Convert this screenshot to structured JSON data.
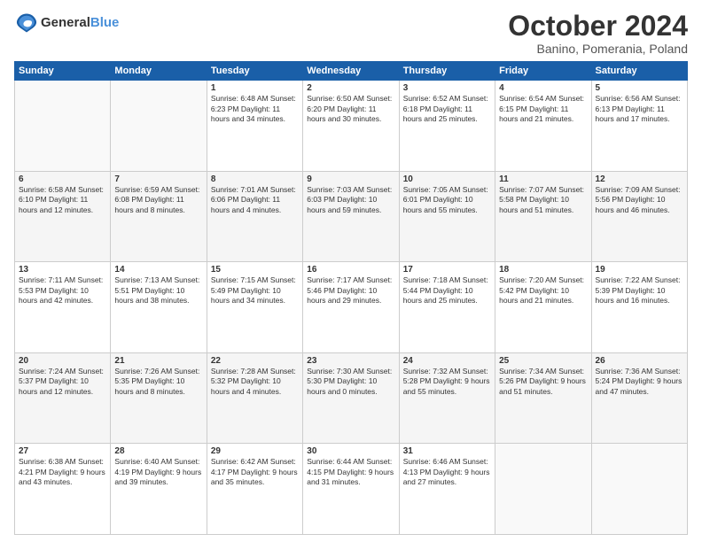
{
  "header": {
    "logo_general": "General",
    "logo_blue": "Blue",
    "month": "October 2024",
    "location": "Banino, Pomerania, Poland"
  },
  "days_of_week": [
    "Sunday",
    "Monday",
    "Tuesday",
    "Wednesday",
    "Thursday",
    "Friday",
    "Saturday"
  ],
  "weeks": [
    [
      {
        "day": "",
        "info": ""
      },
      {
        "day": "",
        "info": ""
      },
      {
        "day": "1",
        "info": "Sunrise: 6:48 AM\nSunset: 6:23 PM\nDaylight: 11 hours\nand 34 minutes."
      },
      {
        "day": "2",
        "info": "Sunrise: 6:50 AM\nSunset: 6:20 PM\nDaylight: 11 hours\nand 30 minutes."
      },
      {
        "day": "3",
        "info": "Sunrise: 6:52 AM\nSunset: 6:18 PM\nDaylight: 11 hours\nand 25 minutes."
      },
      {
        "day": "4",
        "info": "Sunrise: 6:54 AM\nSunset: 6:15 PM\nDaylight: 11 hours\nand 21 minutes."
      },
      {
        "day": "5",
        "info": "Sunrise: 6:56 AM\nSunset: 6:13 PM\nDaylight: 11 hours\nand 17 minutes."
      }
    ],
    [
      {
        "day": "6",
        "info": "Sunrise: 6:58 AM\nSunset: 6:10 PM\nDaylight: 11 hours\nand 12 minutes."
      },
      {
        "day": "7",
        "info": "Sunrise: 6:59 AM\nSunset: 6:08 PM\nDaylight: 11 hours\nand 8 minutes."
      },
      {
        "day": "8",
        "info": "Sunrise: 7:01 AM\nSunset: 6:06 PM\nDaylight: 11 hours\nand 4 minutes."
      },
      {
        "day": "9",
        "info": "Sunrise: 7:03 AM\nSunset: 6:03 PM\nDaylight: 10 hours\nand 59 minutes."
      },
      {
        "day": "10",
        "info": "Sunrise: 7:05 AM\nSunset: 6:01 PM\nDaylight: 10 hours\nand 55 minutes."
      },
      {
        "day": "11",
        "info": "Sunrise: 7:07 AM\nSunset: 5:58 PM\nDaylight: 10 hours\nand 51 minutes."
      },
      {
        "day": "12",
        "info": "Sunrise: 7:09 AM\nSunset: 5:56 PM\nDaylight: 10 hours\nand 46 minutes."
      }
    ],
    [
      {
        "day": "13",
        "info": "Sunrise: 7:11 AM\nSunset: 5:53 PM\nDaylight: 10 hours\nand 42 minutes."
      },
      {
        "day": "14",
        "info": "Sunrise: 7:13 AM\nSunset: 5:51 PM\nDaylight: 10 hours\nand 38 minutes."
      },
      {
        "day": "15",
        "info": "Sunrise: 7:15 AM\nSunset: 5:49 PM\nDaylight: 10 hours\nand 34 minutes."
      },
      {
        "day": "16",
        "info": "Sunrise: 7:17 AM\nSunset: 5:46 PM\nDaylight: 10 hours\nand 29 minutes."
      },
      {
        "day": "17",
        "info": "Sunrise: 7:18 AM\nSunset: 5:44 PM\nDaylight: 10 hours\nand 25 minutes."
      },
      {
        "day": "18",
        "info": "Sunrise: 7:20 AM\nSunset: 5:42 PM\nDaylight: 10 hours\nand 21 minutes."
      },
      {
        "day": "19",
        "info": "Sunrise: 7:22 AM\nSunset: 5:39 PM\nDaylight: 10 hours\nand 16 minutes."
      }
    ],
    [
      {
        "day": "20",
        "info": "Sunrise: 7:24 AM\nSunset: 5:37 PM\nDaylight: 10 hours\nand 12 minutes."
      },
      {
        "day": "21",
        "info": "Sunrise: 7:26 AM\nSunset: 5:35 PM\nDaylight: 10 hours\nand 8 minutes."
      },
      {
        "day": "22",
        "info": "Sunrise: 7:28 AM\nSunset: 5:32 PM\nDaylight: 10 hours\nand 4 minutes."
      },
      {
        "day": "23",
        "info": "Sunrise: 7:30 AM\nSunset: 5:30 PM\nDaylight: 10 hours\nand 0 minutes."
      },
      {
        "day": "24",
        "info": "Sunrise: 7:32 AM\nSunset: 5:28 PM\nDaylight: 9 hours\nand 55 minutes."
      },
      {
        "day": "25",
        "info": "Sunrise: 7:34 AM\nSunset: 5:26 PM\nDaylight: 9 hours\nand 51 minutes."
      },
      {
        "day": "26",
        "info": "Sunrise: 7:36 AM\nSunset: 5:24 PM\nDaylight: 9 hours\nand 47 minutes."
      }
    ],
    [
      {
        "day": "27",
        "info": "Sunrise: 6:38 AM\nSunset: 4:21 PM\nDaylight: 9 hours\nand 43 minutes."
      },
      {
        "day": "28",
        "info": "Sunrise: 6:40 AM\nSunset: 4:19 PM\nDaylight: 9 hours\nand 39 minutes."
      },
      {
        "day": "29",
        "info": "Sunrise: 6:42 AM\nSunset: 4:17 PM\nDaylight: 9 hours\nand 35 minutes."
      },
      {
        "day": "30",
        "info": "Sunrise: 6:44 AM\nSunset: 4:15 PM\nDaylight: 9 hours\nand 31 minutes."
      },
      {
        "day": "31",
        "info": "Sunrise: 6:46 AM\nSunset: 4:13 PM\nDaylight: 9 hours\nand 27 minutes."
      },
      {
        "day": "",
        "info": ""
      },
      {
        "day": "",
        "info": ""
      }
    ]
  ]
}
